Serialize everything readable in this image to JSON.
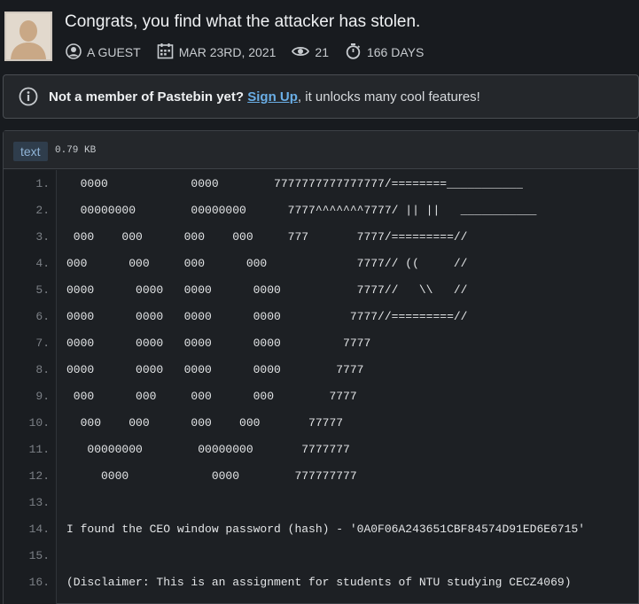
{
  "paste": {
    "title": "Congrats, you find what the attacker has stolen.",
    "author": "A GUEST",
    "date": "MAR 23RD, 2021",
    "views": "21",
    "expiry": "166 DAYS"
  },
  "notice": {
    "lead": "Not a member of Pastebin yet?",
    "signup_label": "Sign Up",
    "rest": ", it unlocks many cool features!"
  },
  "code": {
    "syntax_label": "text",
    "size": "0.79 KB",
    "lines": [
      {
        "n": "1.",
        "text": "  0000            0000        7777777777777777/========___________"
      },
      {
        "n": "2.",
        "text": "  00000000        00000000      7777^^^^^^^7777/ || ||   ___________"
      },
      {
        "n": "3.",
        "text": " 000    000      000    000     777       7777/=========//"
      },
      {
        "n": "4.",
        "text": "000      000     000      000             7777// ((     //"
      },
      {
        "n": "5.",
        "text": "0000      0000   0000      0000           7777//   \\\\   //"
      },
      {
        "n": "6.",
        "text": "0000      0000   0000      0000          7777//=========//"
      },
      {
        "n": "7.",
        "text": "0000      0000   0000      0000         7777"
      },
      {
        "n": "8.",
        "text": "0000      0000   0000      0000        7777"
      },
      {
        "n": "9.",
        "text": " 000      000     000      000        7777"
      },
      {
        "n": "10.",
        "text": "  000    000      000    000       77777"
      },
      {
        "n": "11.",
        "text": "   00000000        00000000       7777777"
      },
      {
        "n": "12.",
        "text": "     0000            0000        777777777"
      },
      {
        "n": "13.",
        "text": ""
      },
      {
        "n": "14.",
        "text": "I found the CEO window password (hash) - '0A0F06A243651CBF84574D91ED6E6715'"
      },
      {
        "n": "15.",
        "text": ""
      },
      {
        "n": "16.",
        "text": "(Disclaimer: This is an assignment for students of NTU studying CECZ4069)"
      }
    ]
  }
}
